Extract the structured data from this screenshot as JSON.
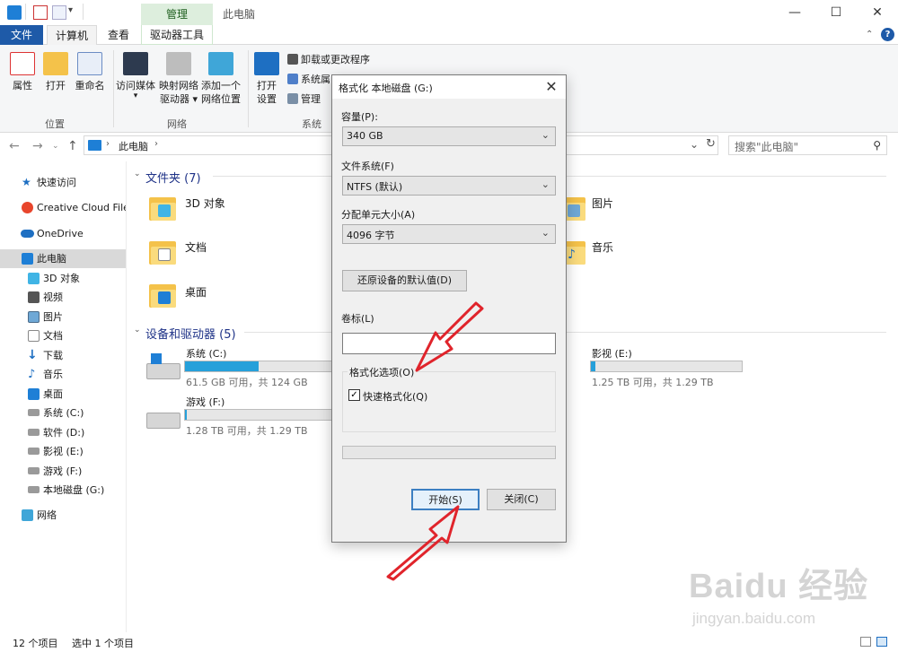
{
  "titlebar": {
    "context_group": "管理",
    "window_title": "此电脑",
    "minimize": "—",
    "maximize": "☐",
    "close": "✕"
  },
  "tabs": {
    "file": "文件",
    "computer": "计算机",
    "view": "查看",
    "drive_tools": "驱动器工具"
  },
  "ribbon": {
    "location_group": "位置",
    "network_group": "网络",
    "system_group": "系统",
    "properties": "属性",
    "open": "打开",
    "rename": "重命名",
    "access_media_1": "访问媒体",
    "access_media_2": "▾",
    "map_drive_1": "映射网络",
    "map_drive_2": "驱动器 ▾",
    "add_location_1": "添加一个",
    "add_location_2": "网络位置",
    "open_settings_1": "打开",
    "open_settings_2": "设置",
    "uninstall": "卸载或更改程序",
    "system_props": "系统属",
    "manage": "管理"
  },
  "address": {
    "path": "此电脑",
    "search_placeholder": "搜索\"此电脑\""
  },
  "nav": {
    "quick_access": "快速访问",
    "creative_cloud": "Creative Cloud Files",
    "onedrive": "OneDrive",
    "this_pc": "此电脑",
    "objects3d": "3D 对象",
    "videos": "视频",
    "pictures": "图片",
    "documents": "文档",
    "downloads": "下载",
    "music": "音乐",
    "desktop": "桌面",
    "drive_c": "系统 (C:)",
    "drive_d": "软件 (D:)",
    "drive_e": "影视 (E:)",
    "drive_f": "游戏 (F:)",
    "drive_g": "本地磁盘 (G:)",
    "network": "网络"
  },
  "main": {
    "folders_header": "文件夹 (7)",
    "devices_header": "设备和驱动器 (5)",
    "folders": {
      "objects3d": "3D 对象",
      "documents": "文档",
      "desktop": "桌面",
      "pictures": "图片",
      "music": "音乐"
    },
    "drives": {
      "c_name": "系统 (C:)",
      "c_info": "61.5 GB 可用，共 124 GB",
      "c_used": 0.5,
      "f_name": "游戏 (F:)",
      "f_info": "1.28 TB 可用，共 1.29 TB",
      "f_used": 0.01,
      "e_name": "影视 (E:)",
      "e_info": "1.25 TB 可用，共 1.29 TB",
      "e_used": 0.03
    }
  },
  "status": {
    "count": "12 个项目",
    "selected": "选中 1 个项目"
  },
  "dialog": {
    "title": "格式化 本地磁盘 (G:)",
    "close": "✕",
    "capacity_label": "容量(P):",
    "capacity_value": "340 GB",
    "fs_label": "文件系统(F)",
    "fs_value": "NTFS (默认)",
    "alloc_label": "分配单元大小(A)",
    "alloc_value": "4096 字节",
    "restore_defaults": "还原设备的默认值(D)",
    "volume_label": "卷标(L)",
    "volume_value": "",
    "options_legend": "格式化选项(O)",
    "quick_format": "快速格式化(Q)",
    "quick_checked": "✓",
    "start": "开始(S)",
    "close_button": "关闭(C)",
    "chevron": "⌄"
  },
  "colors": {
    "accent_blue": "#1e5aa8",
    "drive_fill": "#26a0da",
    "arrow_red": "#e0242b",
    "section_header": "#1e3287"
  },
  "watermark": {
    "main": "Baidu 经验",
    "sub": "jingyan.baidu.com"
  }
}
